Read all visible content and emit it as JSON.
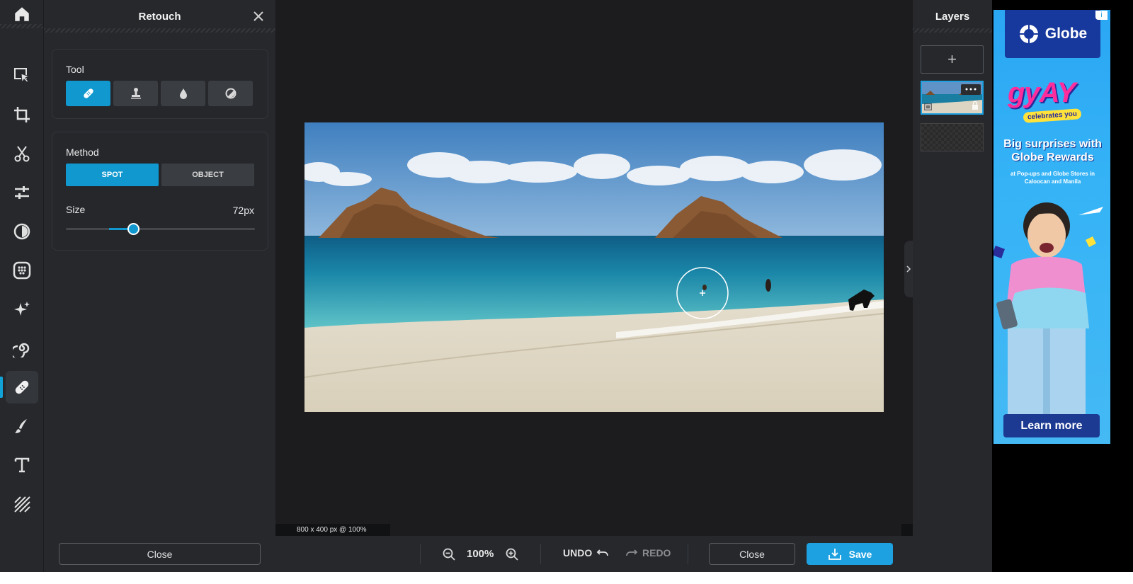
{
  "panel": {
    "title": "Retouch",
    "tool_label": "Tool",
    "tools": [
      {
        "name": "heal",
        "icon": "bandage-icon",
        "selected": true
      },
      {
        "name": "clone",
        "icon": "stamp-icon",
        "selected": false
      },
      {
        "name": "blur",
        "icon": "drop-icon",
        "selected": false
      },
      {
        "name": "dodge-burn",
        "icon": "half-circle-icon",
        "selected": false
      }
    ],
    "method_label": "Method",
    "method_spot": "SPOT",
    "method_object": "OBJECT",
    "size_label": "Size",
    "size_value": "72px",
    "size_fraction": 0.36,
    "close_label": "Close"
  },
  "rail": {
    "icons": [
      "home-icon",
      "arrange-icon",
      "crop-icon",
      "cutout-icon",
      "adjust-icon",
      "effects-icon",
      "filter-icon",
      "ai-sparkle-icon",
      "liquify-icon",
      "retouch-icon",
      "draw-icon",
      "text-icon",
      "texture-icon"
    ],
    "active": "retouch-icon"
  },
  "canvas": {
    "dimensions": "800 x 400 px @ 100%"
  },
  "bottom": {
    "zoom": "100%",
    "undo": "UNDO",
    "redo": "REDO",
    "close": "Close",
    "save": "Save"
  },
  "layers": {
    "title": "Layers",
    "add": "+"
  },
  "ad": {
    "brand": "Globe",
    "campaign": "gyAY",
    "tagline": "celebrates you",
    "headline": "Big surprises with Globe Rewards",
    "subtext": "at Pop-ups and Globe Stores in Caloocan and Manila",
    "cta": "Learn more",
    "info": "i"
  },
  "colors": {
    "accent": "#1098cf",
    "save": "#1ea1e0",
    "panel": "#26282c",
    "stage": "#1c1c1f"
  }
}
